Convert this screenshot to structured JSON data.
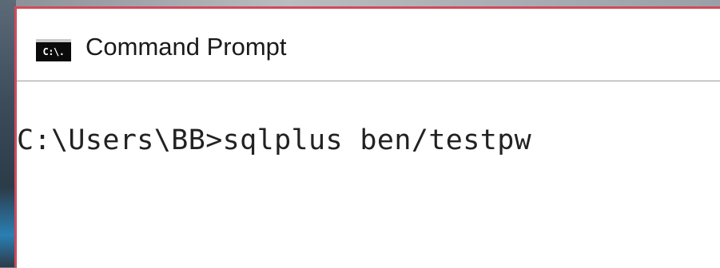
{
  "window": {
    "title": "Command Prompt",
    "icon": "cmd-icon",
    "icon_label": "C:\\."
  },
  "console": {
    "lines": [
      "C:\\Users\\BB>sqlplus ben/testpw"
    ]
  },
  "colors": {
    "window_border": "#d24a5a",
    "console_background": "#ffffff",
    "console_text": "#222222"
  }
}
